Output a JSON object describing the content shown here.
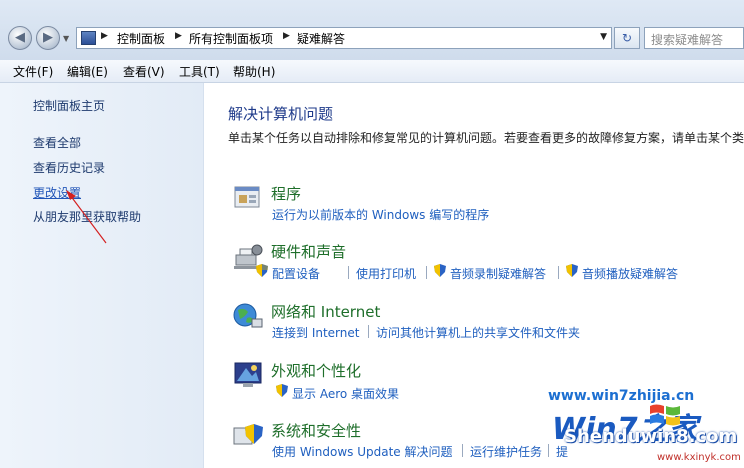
{
  "address": {
    "crumbs": [
      "控制面板",
      "所有控制面板项",
      "疑难解答"
    ],
    "search_placeholder": "搜索疑难解答"
  },
  "menu": [
    "文件(F)",
    "编辑(E)",
    "查看(V)",
    "工具(T)",
    "帮助(H)"
  ],
  "sidebar": {
    "home": "控制面板主页",
    "items": [
      "查看全部",
      "查看历史记录",
      "更改设置",
      "从朋友那里获取帮助"
    ]
  },
  "main": {
    "title": "解决计算机问题",
    "description": "单击某个任务以自动排除和修复常见的计算机问题。若要查看更多的故障修复方案，请单击某个类",
    "categories": [
      {
        "title": "程序",
        "links": [
          "运行为以前版本的 Windows 编写的程序"
        ]
      },
      {
        "title": "硬件和声音",
        "links": [
          "配置设备",
          "使用打印机",
          "音频录制疑难解答",
          "音频播放疑难解答"
        ]
      },
      {
        "title": "网络和 Internet",
        "links": [
          "连接到 Internet",
          "访问其他计算机上的共享文件和文件夹"
        ]
      },
      {
        "title": "外观和个性化",
        "links": [
          "显示 Aero 桌面效果"
        ]
      },
      {
        "title": "系统和安全性",
        "links": [
          "使用 Windows Update 解决问题",
          "运行维护任务",
          "提"
        ]
      }
    ]
  },
  "watermark": {
    "site1": "www.win7zhijia.cn",
    "logo": "Win7之家",
    "site2": "Shenduwin8.com",
    "site3": "www.kxinyk.com"
  },
  "colors": {
    "link": "#1f5fbf",
    "category_title": "#1e6e2a",
    "title": "#1e3a8a"
  }
}
